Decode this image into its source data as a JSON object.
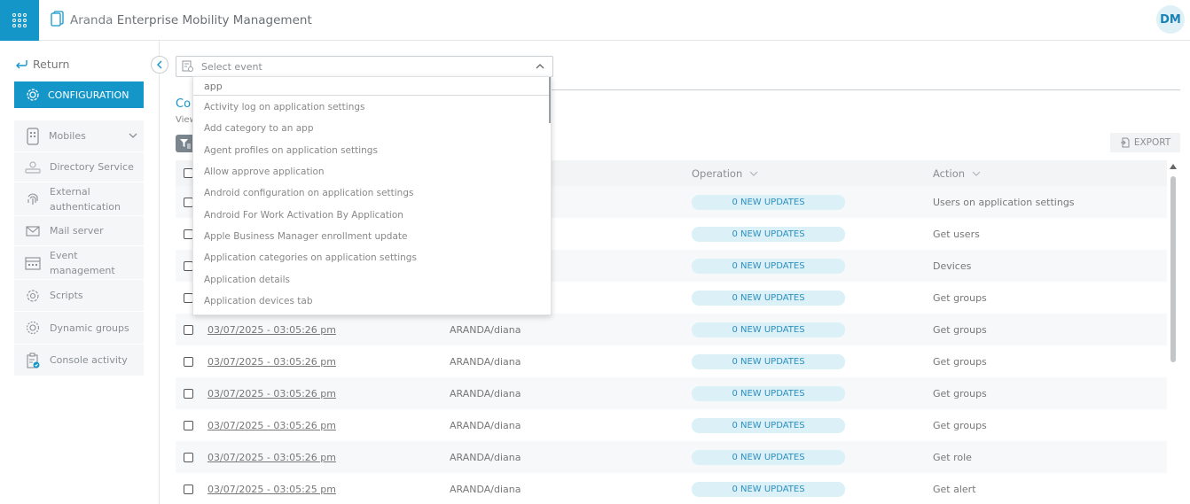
{
  "header": {
    "title_prefix": "Aranda",
    "title_main": "Enterprise Mobility Management",
    "avatar_initials": "DM",
    "brand_color": "#1596c9"
  },
  "sidebar": {
    "return_label": "Return",
    "config_label": "CONFIGURATION",
    "mobiles_label": "Mobiles",
    "items": [
      {
        "label": "Directory Service",
        "icon": "directory-icon"
      },
      {
        "label": "External authentication",
        "icon": "fingerprint-icon"
      },
      {
        "label": "Mail server",
        "icon": "mail-icon"
      },
      {
        "label": "Event management",
        "icon": "event-icon"
      },
      {
        "label": "Scripts",
        "icon": "gear-icon"
      },
      {
        "label": "Dynamic groups",
        "icon": "dynamic-groups-icon"
      },
      {
        "label": "Console activity",
        "icon": "clipboard-check-icon"
      }
    ]
  },
  "event_select": {
    "placeholder": "Select event",
    "search_value": "app",
    "options": [
      "Activity log on application settings",
      "Add category to an app",
      "Agent profiles on application settings",
      "Allow approve application",
      "Android configuration on application settings",
      "Android For Work Activation By Application",
      "Apple Business Manager enrollment update",
      "Application categories on application settings",
      "Application details",
      "Application devices tab"
    ]
  },
  "page": {
    "title_visible": "Co",
    "subtitle_visible": "View"
  },
  "toolbar": {
    "export_label": "EXPORT"
  },
  "table": {
    "headers": {
      "operation": "Operation",
      "action": "Action"
    },
    "rows": [
      {
        "date": "",
        "user": "",
        "operation": "0 NEW UPDATES",
        "action": "Users on application settings"
      },
      {
        "date": "",
        "user": "",
        "operation": "0 NEW UPDATES",
        "action": "Get users"
      },
      {
        "date": "",
        "user": "",
        "operation": "0 NEW UPDATES",
        "action": "Devices"
      },
      {
        "date": "",
        "user": "",
        "operation": "0 NEW UPDATES",
        "action": "Get groups"
      },
      {
        "date": "03/07/2025 - 03:05:26 pm",
        "user": "ARANDA/diana",
        "operation": "0 NEW UPDATES",
        "action": "Get groups"
      },
      {
        "date": "03/07/2025 - 03:05:26 pm",
        "user": "ARANDA/diana",
        "operation": "0 NEW UPDATES",
        "action": "Get groups"
      },
      {
        "date": "03/07/2025 - 03:05:26 pm",
        "user": "ARANDA/diana",
        "operation": "0 NEW UPDATES",
        "action": "Get groups"
      },
      {
        "date": "03/07/2025 - 03:05:26 pm",
        "user": "ARANDA/diana",
        "operation": "0 NEW UPDATES",
        "action": "Get groups"
      },
      {
        "date": "03/07/2025 - 03:05:26 pm",
        "user": "ARANDA/diana",
        "operation": "0 NEW UPDATES",
        "action": "Get role"
      },
      {
        "date": "03/07/2025 - 03:05:25 pm",
        "user": "ARANDA/diana",
        "operation": "0 NEW UPDATES",
        "action": "Get alert"
      }
    ]
  }
}
